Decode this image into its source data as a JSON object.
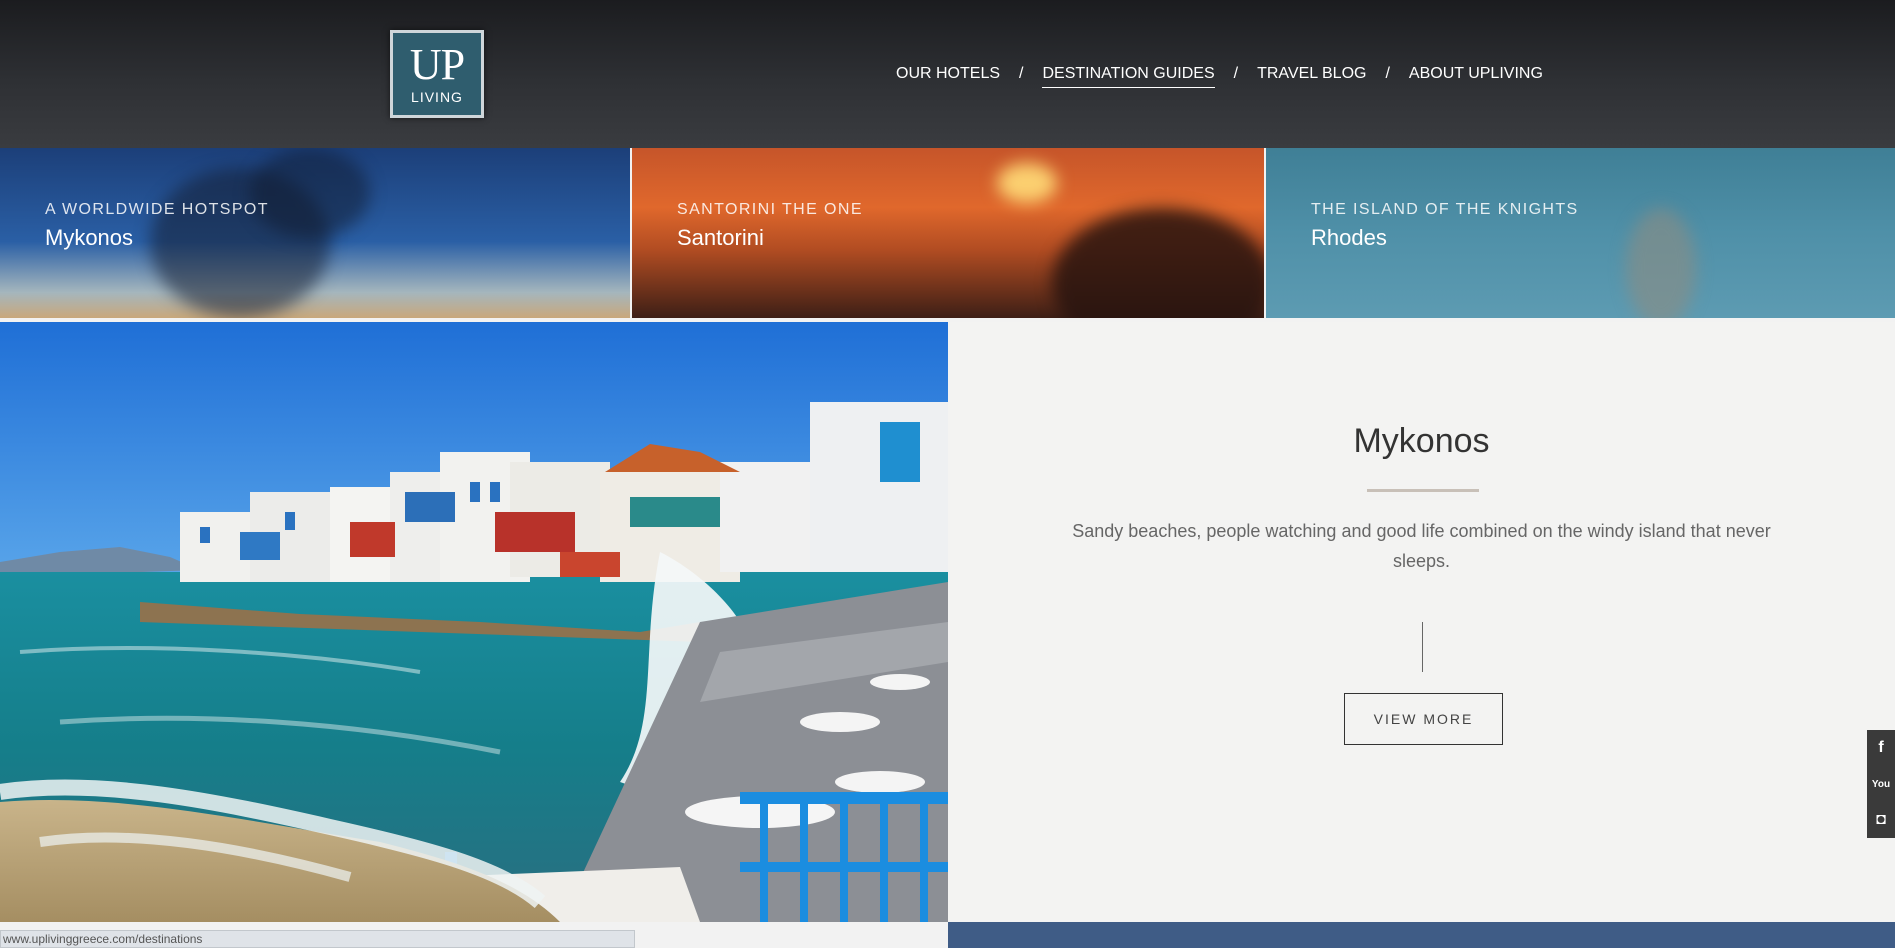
{
  "brand": {
    "logo_top": "UP",
    "logo_bottom": "LIVING"
  },
  "nav": {
    "items": [
      {
        "label": "OUR HOTELS"
      },
      {
        "label": "DESTINATION GUIDES"
      },
      {
        "label": "TRAVEL BLOG"
      },
      {
        "label": "ABOUT UPLIVING"
      }
    ],
    "separator": "/"
  },
  "tiles": [
    {
      "kicker": "A WORLDWIDE HOTSPOT",
      "name": "Mykonos"
    },
    {
      "kicker": "SANTORINI THE ONE",
      "name": "Santorini"
    },
    {
      "kicker": "THE ISLAND OF THE KNIGHTS",
      "name": "Rhodes"
    }
  ],
  "feature": {
    "title": "Mykonos",
    "description": "Sandy beaches, people watching and good life combined on the windy island that never sleeps.",
    "button": "VIEW MORE"
  },
  "social": {
    "facebook": "f",
    "youtube": "You",
    "instagram": "◘"
  },
  "status_url": "www.uplivinggreece.com/destinations",
  "colors": {
    "logo_bg": "#2f5d6e",
    "footer_strip": "#3f5c86",
    "header_bg": "#2e3034"
  }
}
